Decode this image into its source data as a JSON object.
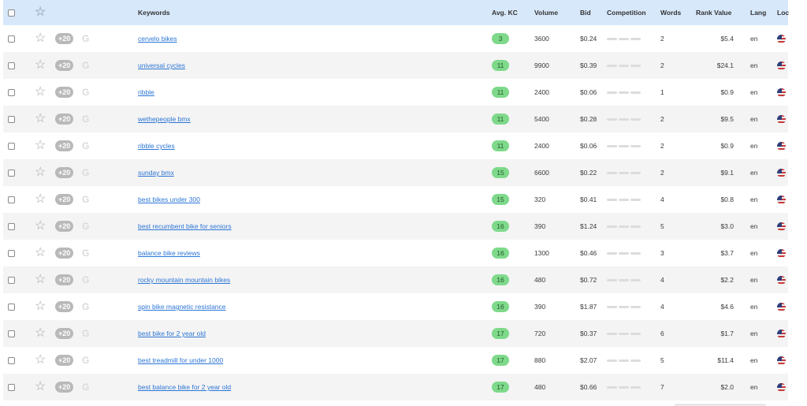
{
  "header": {
    "keywords": "Keywords",
    "avg_kc": "Avg. KC",
    "volume": "Volume",
    "bid": "Bid",
    "competition": "Competition",
    "words": "Words",
    "rank_value": "Rank Value",
    "lang": "Lang",
    "loc": "Loc"
  },
  "icons": {
    "star": "star-icon",
    "plus_badge": "+20",
    "google": "G",
    "flag": "us-flag-icon"
  },
  "colors": {
    "header_bg": "#d7e8fb",
    "link": "#2c76d6",
    "kc_badge": "#7ed98a"
  },
  "rows": [
    {
      "keyword": "cervelo bikes",
      "kc": "3",
      "volume": "3600",
      "bid": "$0.24",
      "words": "2",
      "rank_value": "$5.4",
      "lang": "en"
    },
    {
      "keyword": "universal cycles",
      "kc": "11",
      "volume": "9900",
      "bid": "$0.39",
      "words": "2",
      "rank_value": "$24.1",
      "lang": "en"
    },
    {
      "keyword": "ribble",
      "kc": "11",
      "volume": "2400",
      "bid": "$0.06",
      "words": "1",
      "rank_value": "$0.9",
      "lang": "en"
    },
    {
      "keyword": "wethepeople bmx",
      "kc": "11",
      "volume": "5400",
      "bid": "$0.28",
      "words": "2",
      "rank_value": "$9.5",
      "lang": "en"
    },
    {
      "keyword": "ribble cycles",
      "kc": "11",
      "volume": "2400",
      "bid": "$0.06",
      "words": "2",
      "rank_value": "$0.9",
      "lang": "en"
    },
    {
      "keyword": "sunday bmx",
      "kc": "15",
      "volume": "6600",
      "bid": "$0.22",
      "words": "2",
      "rank_value": "$9.1",
      "lang": "en"
    },
    {
      "keyword": "best bikes under 300",
      "kc": "15",
      "volume": "320",
      "bid": "$0.41",
      "words": "4",
      "rank_value": "$0.8",
      "lang": "en"
    },
    {
      "keyword": "best recumbent bike for seniors",
      "kc": "16",
      "volume": "390",
      "bid": "$1.24",
      "words": "5",
      "rank_value": "$3.0",
      "lang": "en"
    },
    {
      "keyword": "balance bike reviews",
      "kc": "16",
      "volume": "1300",
      "bid": "$0.46",
      "words": "3",
      "rank_value": "$3.7",
      "lang": "en"
    },
    {
      "keyword": "rocky mountain mountain bikes",
      "kc": "16",
      "volume": "480",
      "bid": "$0.72",
      "words": "4",
      "rank_value": "$2.2",
      "lang": "en"
    },
    {
      "keyword": "spin bike magnetic resistance",
      "kc": "16",
      "volume": "390",
      "bid": "$1.87",
      "words": "4",
      "rank_value": "$4.6",
      "lang": "en"
    },
    {
      "keyword": "best bike for 2 year old",
      "kc": "17",
      "volume": "720",
      "bid": "$0.37",
      "words": "6",
      "rank_value": "$1.7",
      "lang": "en"
    },
    {
      "keyword": "best treadmill for under 1000",
      "kc": "17",
      "volume": "880",
      "bid": "$2.07",
      "words": "5",
      "rank_value": "$11.4",
      "lang": "en"
    },
    {
      "keyword": "best balance bike for 2 year old",
      "kc": "17",
      "volume": "480",
      "bid": "$0.66",
      "words": "7",
      "rank_value": "$2.0",
      "lang": "en"
    }
  ]
}
